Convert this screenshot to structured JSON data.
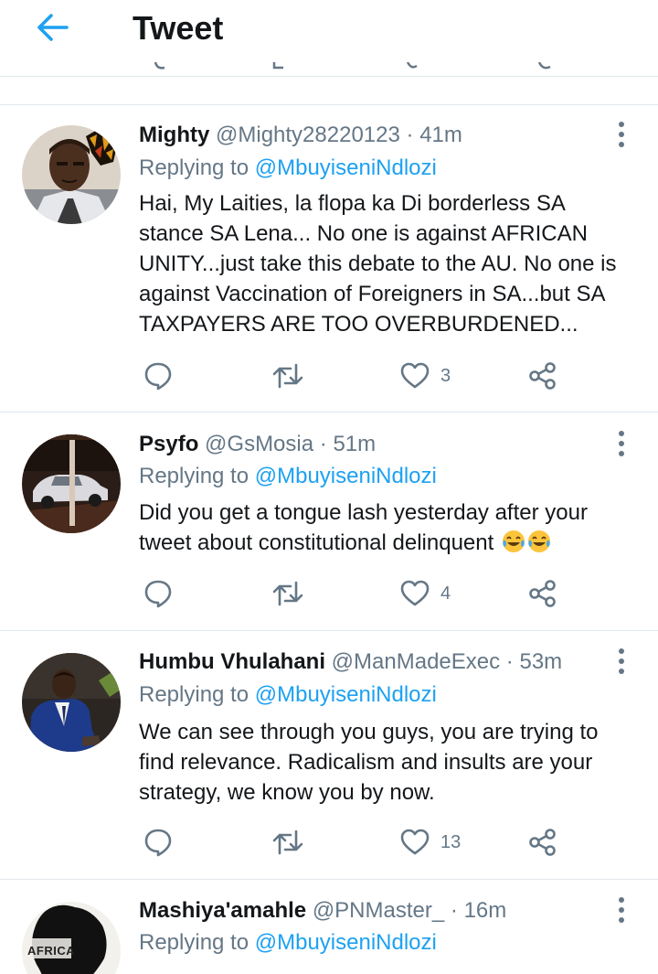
{
  "header": {
    "title": "Tweet",
    "back_icon": "arrow-left-icon"
  },
  "colors": {
    "accent": "#1da1f2",
    "secondary_text": "#657786",
    "divider": "#e1e8ed"
  },
  "tweets": [
    {
      "name": "Mighty",
      "handle": "@Mighty28220123",
      "separator": "·",
      "time": "41m",
      "replying_prefix": "Replying to",
      "replying_to": "@MbuyiseniNdlozi",
      "text_lines": [
        "Hai, My Laities, la flopa ka Di borderless SA",
        "stance SA Lena... No one is against AFRICAN",
        "UNITY...just take this debate to the AU. No one is",
        "against Vaccination of Foreigners in SA...but SA",
        "TAXPAYERS ARE TOO OVERBURDENED..."
      ],
      "likes": "3"
    },
    {
      "name": "Psyfo",
      "handle": "@GsMosia",
      "separator": "·",
      "time": "51m",
      "replying_prefix": "Replying to",
      "replying_to": "@MbuyiseniNdlozi",
      "text_lines": [
        "Did you get a tongue lash yesterday after your",
        "tweet about constitutional delinquent"
      ],
      "emoji": "tears-of-joy-emoji",
      "likes": "4"
    },
    {
      "name": "Humbu Vhulahani",
      "handle": "@ManMadeExec",
      "separator": "·",
      "time": "53m",
      "replying_prefix": "Replying to",
      "replying_to": "@MbuyiseniNdlozi",
      "text_lines": [
        "We can see through you guys, you are trying to",
        "find relevance. Radicalism and insults are your",
        "strategy, we know you by now."
      ],
      "likes": "13"
    },
    {
      "name": "Mashiya'amahle",
      "handle": "@PNMaster_",
      "separator": "·",
      "time": "16m",
      "replying_prefix": "Replying to",
      "replying_to": "@MbuyiseniNdlozi",
      "avatar_text": "AFRICA"
    }
  ]
}
